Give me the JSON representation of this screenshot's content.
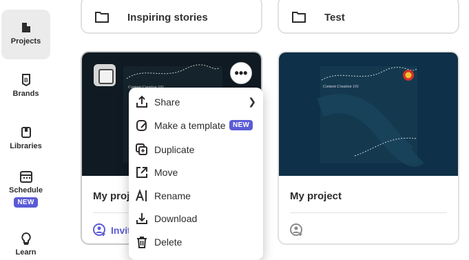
{
  "sidebar": {
    "items": [
      {
        "label": "Projects",
        "icon": "projects-icon"
      },
      {
        "label": "Brands",
        "icon": "brands-icon"
      },
      {
        "label": "Libraries",
        "icon": "libraries-icon"
      },
      {
        "label": "Schedule",
        "icon": "schedule-icon",
        "badge": "NEW"
      },
      {
        "label": "Learn",
        "icon": "learn-icon"
      }
    ]
  },
  "folders": [
    {
      "title": "Inspiring stories"
    },
    {
      "title": "Test"
    }
  ],
  "projects": [
    {
      "title": "My proj",
      "invite_label": "Invit",
      "thumb_text": "Content Creation 101"
    },
    {
      "title": "My project",
      "thumb_text": "Content Creation 101"
    }
  ],
  "context_menu": {
    "items": [
      {
        "label": "Share",
        "icon": "share-icon"
      },
      {
        "label": "Make a template",
        "icon": "template-icon",
        "badge": "NEW"
      },
      {
        "label": "Duplicate",
        "icon": "duplicate-icon"
      },
      {
        "label": "Move",
        "icon": "move-icon"
      },
      {
        "label": "Rename",
        "icon": "rename-icon"
      },
      {
        "label": "Download",
        "icon": "download-icon"
      },
      {
        "label": "Delete",
        "icon": "delete-icon"
      }
    ]
  },
  "colors": {
    "accent": "#5b5bd6",
    "thumb_blue": "#0e3048"
  }
}
